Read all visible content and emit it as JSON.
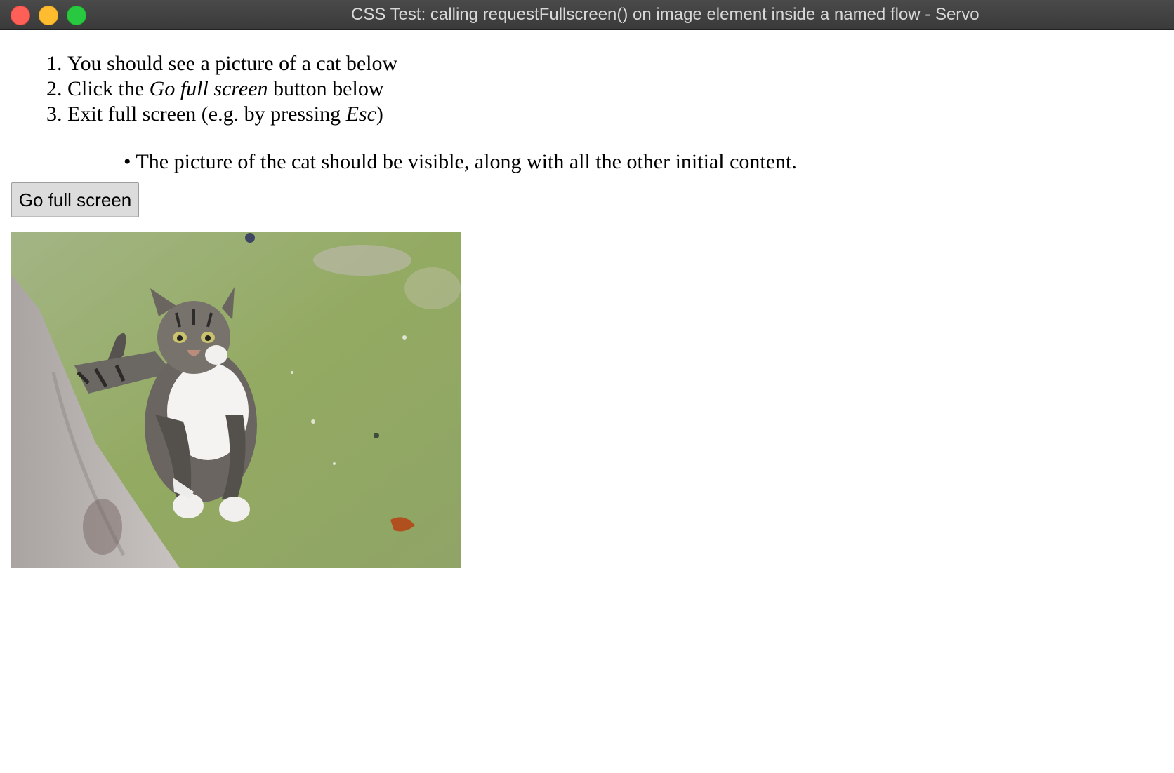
{
  "window": {
    "title": "CSS Test: calling requestFullscreen() on image element inside a named flow - Servo"
  },
  "steps": [
    {
      "before": "You should see a picture of a cat below",
      "em": "",
      "after": ""
    },
    {
      "before": "Click the ",
      "em": "Go full screen",
      "after": " button below"
    },
    {
      "before": "Exit full screen (e.g. by pressing ",
      "em": "Esc",
      "after": ")"
    }
  ],
  "expectation": "The picture of the cat should be visible, along with all the other initial content.",
  "button": {
    "label": "Go full screen"
  },
  "colors": {
    "titlebar": "#3c3c3c",
    "close": "#fe5f57",
    "minimize": "#febc2e",
    "maximize": "#28c840",
    "button_bg": "#dcdcdc"
  }
}
